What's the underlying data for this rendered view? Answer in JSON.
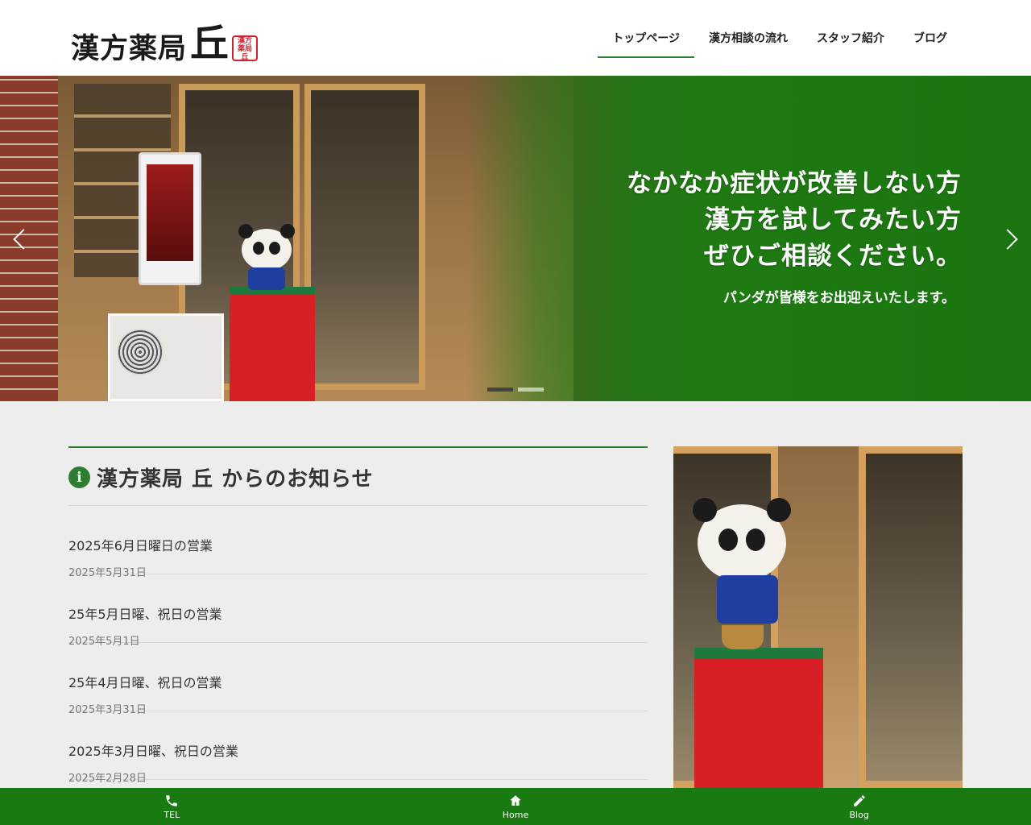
{
  "header": {
    "logo_main": "漢方薬局",
    "logo_big": "丘",
    "logo_seal": "漢方薬局丘"
  },
  "nav": {
    "items": [
      {
        "label": "トップページ",
        "active": true
      },
      {
        "label": "漢方相談の流れ",
        "active": false
      },
      {
        "label": "スタッフ紹介",
        "active": false
      },
      {
        "label": "ブログ",
        "active": false
      }
    ]
  },
  "hero": {
    "lines": [
      "なかなか症状が改善しない方",
      "漢方を試してみたい方",
      "ぜひご相談ください。"
    ],
    "sub": "パンダが皆様をお出迎えいたします。",
    "slide_count": 2,
    "active_slide": 1,
    "accent_color": "#1f7a12"
  },
  "news": {
    "title": "漢方薬局 丘 からのお知らせ",
    "items": [
      {
        "title": "2025年6月日曜日の営業",
        "date": "2025年5月31日"
      },
      {
        "title": "25年5月日曜、祝日の営業",
        "date": "2025年5月1日"
      },
      {
        "title": "25年4月日曜、祝日の営業",
        "date": "2025年3月31日"
      },
      {
        "title": "2025年3月日曜、祝日の営業",
        "date": "2025年2月28日"
      }
    ]
  },
  "bottom_bar": {
    "items": [
      {
        "label": "TEL",
        "icon": "phone-icon"
      },
      {
        "label": "Home",
        "icon": "home-icon"
      },
      {
        "label": "Blog",
        "icon": "pencil-icon"
      }
    ],
    "color": "#1a7a12"
  }
}
